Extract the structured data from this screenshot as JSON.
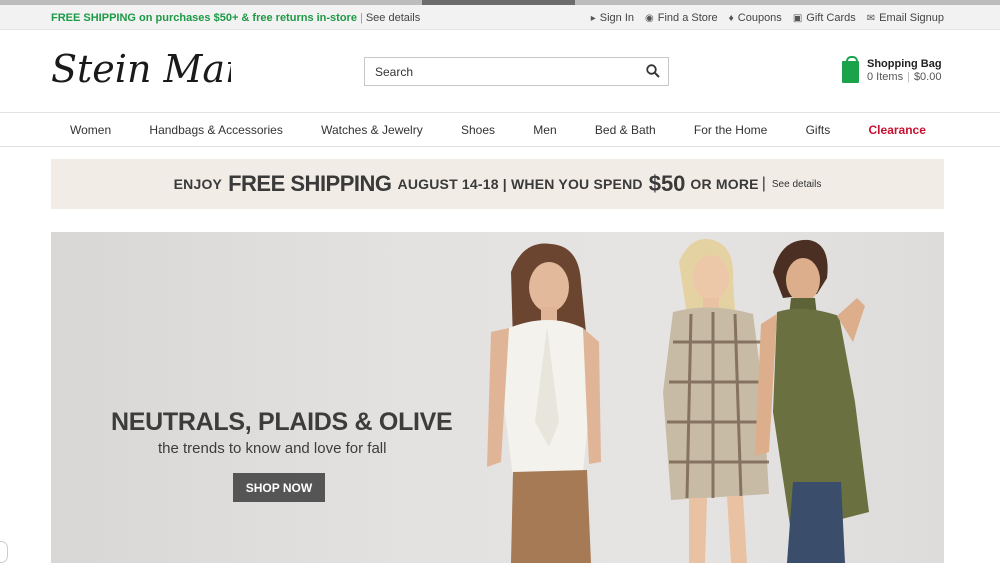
{
  "utility": {
    "promo": "FREE SHIPPING on purchases $50+ & free returns in-store",
    "details": "See details",
    "links": [
      {
        "label": "Sign In",
        "icon": "arrow-icon"
      },
      {
        "label": "Find a Store",
        "icon": "location-pin-icon"
      },
      {
        "label": "Coupons",
        "icon": "tag-icon"
      },
      {
        "label": "Gift Cards",
        "icon": "gift-card-icon"
      },
      {
        "label": "Email Signup",
        "icon": "envelope-icon"
      }
    ]
  },
  "header": {
    "logo_text": "Stein Mart",
    "search_placeholder": "Search",
    "bag": {
      "title": "Shopping Bag",
      "items": "0 Items",
      "total": "$0.00"
    }
  },
  "nav": [
    "Women",
    "Handbags & Accessories",
    "Watches & Jewelry",
    "Shoes",
    "Men",
    "Bed & Bath",
    "For the Home",
    "Gifts",
    "Clearance"
  ],
  "ship_banner": {
    "enjoy": "ENJOY",
    "free_shipping": "FREE SHIPPING",
    "dates": "AUGUST 14-18 | WHEN YOU SPEND",
    "amount": "$50",
    "or_more": "OR MORE",
    "details": "See details"
  },
  "hero": {
    "headline": "NEUTRALS, PLAIDS & OLIVE",
    "subhead": "the trends to know and love for fall",
    "cta": "SHOP NOW"
  },
  "colors": {
    "promo_green": "#1d9a45",
    "clearance_red": "#c8102e",
    "bag_green": "#1aa34a",
    "banner_bg": "#f1ece6"
  }
}
